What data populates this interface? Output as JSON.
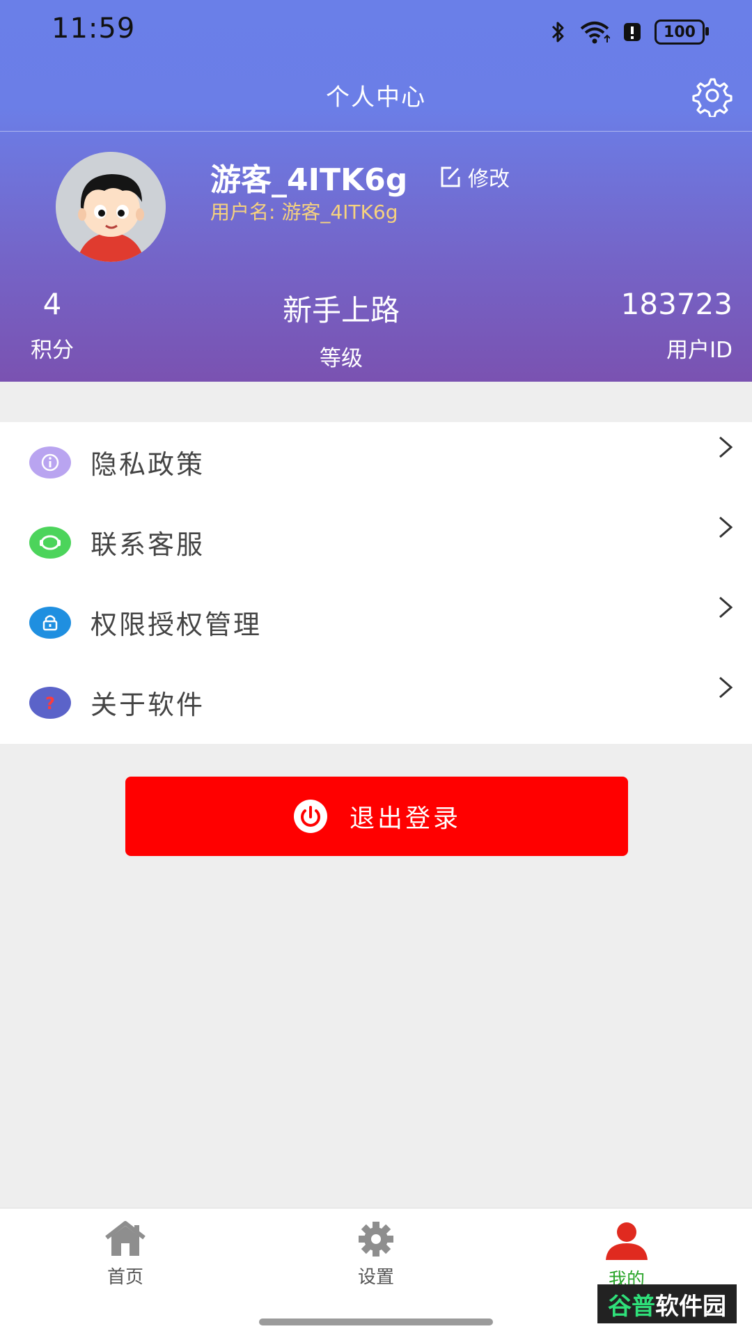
{
  "status_bar": {
    "time": "11:59",
    "battery": "100"
  },
  "header": {
    "title": "个人中心"
  },
  "profile": {
    "nickname": "游客_4ITK6g",
    "edit_label": "修改",
    "username_prefix": "用户名: ",
    "username": "游客_4ITK6g"
  },
  "stats": [
    {
      "value": "4",
      "label": "积分"
    },
    {
      "value": "新手上路",
      "label": "等级"
    },
    {
      "value": "183723",
      "label": "用户ID"
    }
  ],
  "menu": [
    {
      "label": "隐私政策",
      "icon": "info-icon",
      "color": "#b9a4f0"
    },
    {
      "label": "联系客服",
      "icon": "headset-icon",
      "color": "#4cd45b"
    },
    {
      "label": "权限授权管理",
      "icon": "lock-icon",
      "color": "#1f8fe0"
    },
    {
      "label": "关于软件",
      "icon": "question-icon",
      "color": "#5b63c9"
    }
  ],
  "logout": {
    "label": "退出登录",
    "color": "#ff0000"
  },
  "tabbar": [
    {
      "label": "首页",
      "icon": "home-icon"
    },
    {
      "label": "设置",
      "icon": "gear-icon"
    },
    {
      "label": "我的",
      "icon": "user-icon",
      "active": true
    }
  ],
  "watermark": {
    "part1": "谷普",
    "part2": "软件园"
  },
  "colors": {
    "header_top": "#6a7fe8",
    "header_bottom": "#7a52b1",
    "accent_green": "#2aa52a",
    "username_color": "#f6d27e"
  }
}
